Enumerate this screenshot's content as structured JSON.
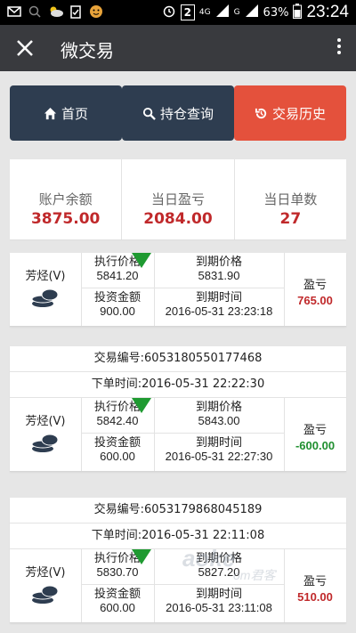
{
  "status_bar": {
    "battery": "63%",
    "time": "23:24",
    "notify_box": "2",
    "net1": "4G",
    "net2": "G"
  },
  "app_bar": {
    "title": "微交易"
  },
  "nav": {
    "home": "首页",
    "holdings": "持仓查询",
    "history": "交易历史"
  },
  "summary": {
    "balance_label": "账户余额",
    "balance": "3875.00",
    "daily_pl_label": "当日盈亏",
    "daily_pl": "2084.00",
    "daily_count_label": "当日单数",
    "daily_count": "27"
  },
  "labels": {
    "exec_price": "执行价格",
    "due_price": "到期价格",
    "invest": "投资金额",
    "due_time": "到期时间",
    "pl": "盈亏"
  },
  "trades": [
    {
      "product": "芳烃(V)",
      "exec_price": "5841.20",
      "due_price": "5831.90",
      "invest": "900.00",
      "due_time": "2016-05-31 23:23:18",
      "pl": "765.00"
    },
    {
      "order_no": "交易编号:6053180550177468",
      "order_time": "下单时间:2016-05-31 22:22:30",
      "product": "芳烃(V)",
      "exec_price": "5842.40",
      "due_price": "5843.00",
      "invest": "600.00",
      "due_time": "2016-05-31 22:27:30",
      "pl": "-600.00"
    },
    {
      "order_no": "交易编号:6053179868045189",
      "order_time": "下单时间:2016-05-31 22:11:08",
      "product": "芳烃(V)",
      "exec_price": "5830.70",
      "due_price": "5827.20",
      "invest": "600.00",
      "due_time": "2016-05-31 23:11:08",
      "pl": "510.00"
    }
  ],
  "watermark": {
    "text1": "aoke",
    "text2": "om君客"
  },
  "colors": {
    "accent_red": "#e4513c",
    "nav_dark": "#2e3d50",
    "profit": "#c0292b",
    "loss": "#1f8f2f",
    "down_arrow": "#1f9a31"
  }
}
